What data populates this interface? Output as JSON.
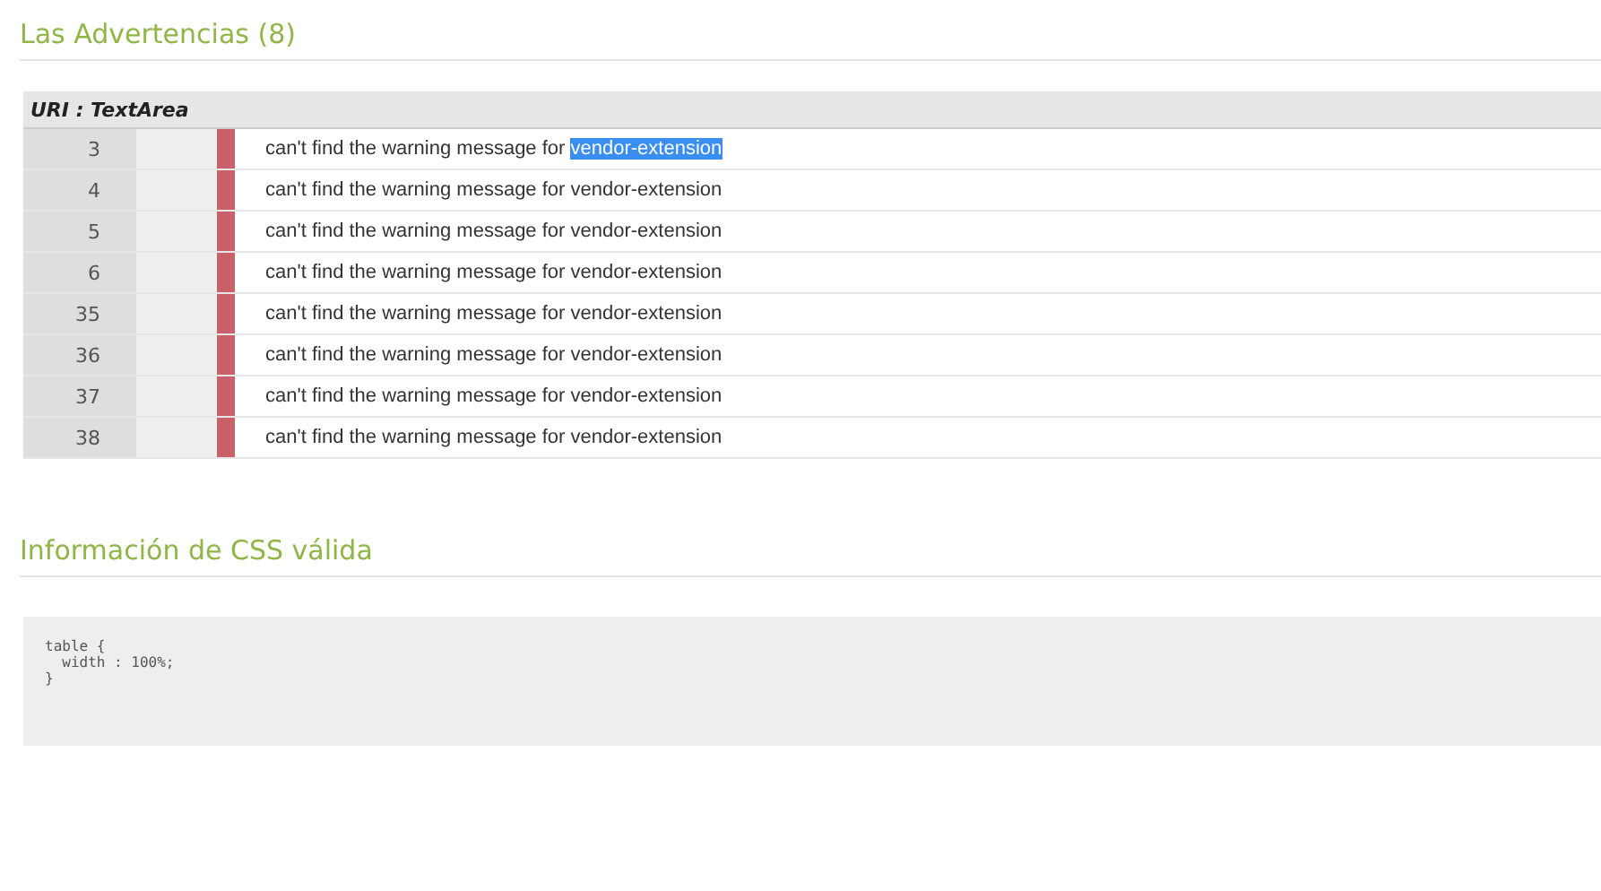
{
  "warnings_section": {
    "title": "Las Advertencias (8)",
    "uri_label": "URI : TextArea",
    "rows": [
      {
        "line": "3",
        "message": "can't find the warning message for ",
        "term": "vendor-extension",
        "highlighted": true
      },
      {
        "line": "4",
        "message": "can't find the warning message for ",
        "term": "vendor-extension",
        "highlighted": false
      },
      {
        "line": "5",
        "message": "can't find the warning message for ",
        "term": "vendor-extension",
        "highlighted": false
      },
      {
        "line": "6",
        "message": "can't find the warning message for ",
        "term": "vendor-extension",
        "highlighted": false
      },
      {
        "line": "35",
        "message": "can't find the warning message for ",
        "term": "vendor-extension",
        "highlighted": false
      },
      {
        "line": "36",
        "message": "can't find the warning message for ",
        "term": "vendor-extension",
        "highlighted": false
      },
      {
        "line": "37",
        "message": "can't find the warning message for ",
        "term": "vendor-extension",
        "highlighted": false
      },
      {
        "line": "38",
        "message": "can't find the warning message for ",
        "term": "vendor-extension",
        "highlighted": false
      }
    ]
  },
  "valid_css_section": {
    "title": "Información de CSS válida",
    "code": "table {\n  width : 100%;\n}"
  }
}
